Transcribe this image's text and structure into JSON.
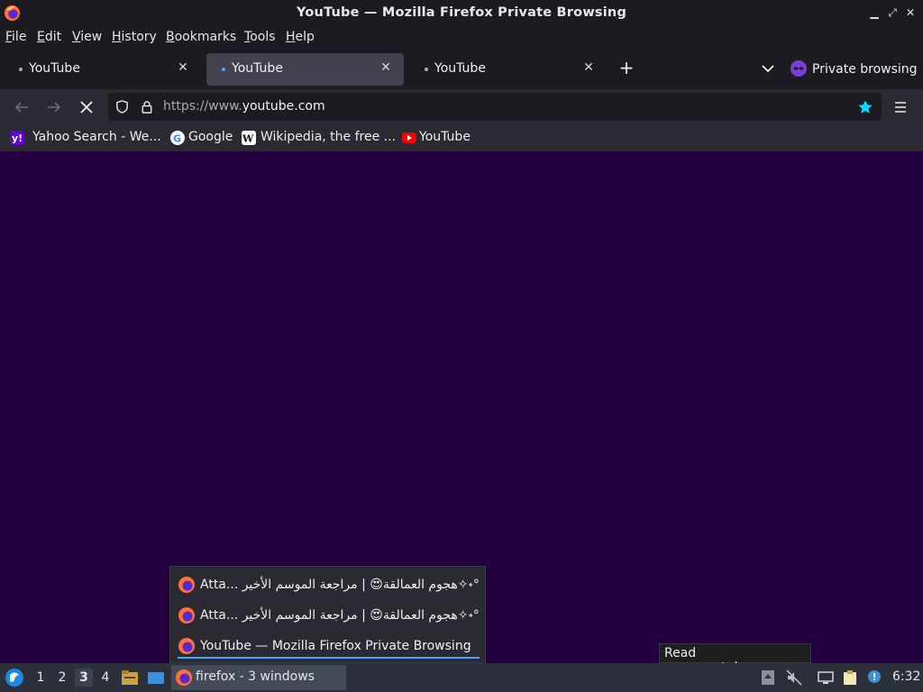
{
  "window": {
    "title": "YouTube — Mozilla Firefox Private Browsing"
  },
  "menubar": {
    "items": [
      {
        "label": "File",
        "mnemonic": "F",
        "rest": "ile"
      },
      {
        "label": "Edit",
        "mnemonic": "E",
        "rest": "dit"
      },
      {
        "label": "View",
        "mnemonic": "V",
        "rest": "iew"
      },
      {
        "label": "History",
        "mnemonic": "H",
        "rest": "istory"
      },
      {
        "label": "Bookmarks",
        "mnemonic": "B",
        "rest": "ookmarks"
      },
      {
        "label": "Tools",
        "mnemonic": "T",
        "rest": "ools"
      },
      {
        "label": "Help",
        "mnemonic": "H",
        "rest": "elp"
      }
    ]
  },
  "tabs": [
    {
      "label": "YouTube",
      "active": false
    },
    {
      "label": "YouTube",
      "active": true
    },
    {
      "label": "YouTube",
      "active": false
    }
  ],
  "private_label": "Private browsing",
  "urlbar": {
    "url_prefix": "https://www.",
    "url_domain": "youtube.com"
  },
  "bookmarks": [
    {
      "label": "Yahoo Search - We...",
      "icon": "yahoo-favicon"
    },
    {
      "label": "Google",
      "icon": "google-favicon"
    },
    {
      "label": "Wikipedia, the free ...",
      "icon": "wikipedia-favicon"
    },
    {
      "label": "YouTube",
      "icon": "youtube-favicon"
    }
  ],
  "window_list_popup": {
    "items": [
      {
        "label": "Atta... هجوم العمالقة😍 | مراجعة الموسم الأخير✧˖°"
      },
      {
        "label": "Atta... هجوم العمالقة😍 | مراجعة الموسم الأخير✧˖°"
      },
      {
        "label": "YouTube — Mozilla Firefox Private Browsing",
        "selected": true
      }
    ]
  },
  "tooltip": "Read www.youtube.com",
  "taskbar": {
    "workspaces": [
      "1",
      "2",
      "3",
      "4"
    ],
    "current_workspace": "3",
    "task_label": "firefox - 3 windows",
    "clock": "6:32"
  },
  "colors": {
    "content_bg": "#25003e",
    "accent_blue": "#4ea3ff",
    "bookmark_star": "#00ddff"
  }
}
